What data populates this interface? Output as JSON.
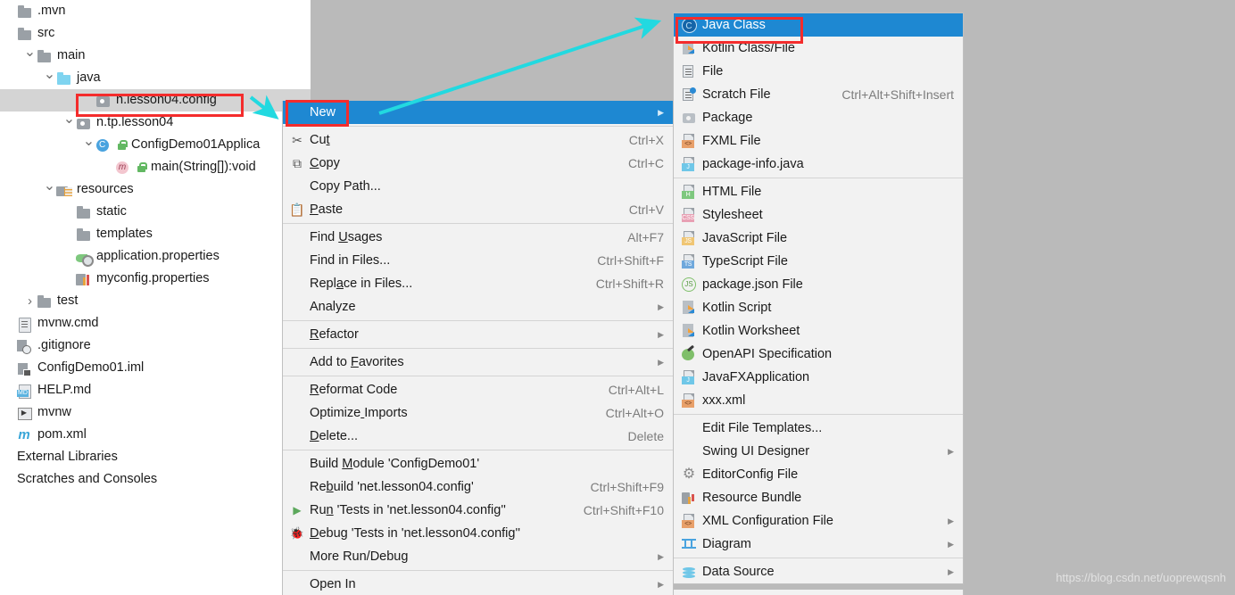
{
  "tree": {
    "items": [
      {
        "label": ".mvn",
        "indent": 0,
        "twist": "",
        "icon": "folder"
      },
      {
        "label": "src",
        "indent": 0,
        "twist": "",
        "icon": "folder"
      },
      {
        "label": "main",
        "indent": 1,
        "twist": "v",
        "icon": "folder"
      },
      {
        "label": "java",
        "indent": 2,
        "twist": "v",
        "icon": "folder-blue"
      },
      {
        "label": "n.lesson04.config",
        "indent": 4,
        "twist": "",
        "icon": "package",
        "selected": true
      },
      {
        "label": "n.tp.lesson04",
        "indent": 3,
        "twist": "v",
        "icon": "package"
      },
      {
        "label": "ConfigDemo01Applica",
        "indent": 4,
        "twist": "v",
        "icon": "spring-class",
        "lock": true
      },
      {
        "label": "main(String[]):void",
        "indent": 5,
        "twist": "",
        "icon": "method",
        "lock": true
      },
      {
        "label": "resources",
        "indent": 2,
        "twist": "v",
        "icon": "resources-folder"
      },
      {
        "label": "static",
        "indent": 3,
        "twist": "",
        "icon": "folder"
      },
      {
        "label": "templates",
        "indent": 3,
        "twist": "",
        "icon": "folder"
      },
      {
        "label": "application.properties",
        "indent": 3,
        "twist": "",
        "icon": "app-properties"
      },
      {
        "label": "myconfig.properties",
        "indent": 3,
        "twist": "",
        "icon": "properties"
      },
      {
        "label": "test",
        "indent": 1,
        "twist": ">",
        "icon": "folder"
      },
      {
        "label": "mvnw.cmd",
        "indent": 0,
        "twist": "",
        "icon": "file"
      },
      {
        "label": ".gitignore",
        "indent": 0,
        "twist": "",
        "icon": "gitignore"
      },
      {
        "label": "ConfigDemo01.iml",
        "indent": 0,
        "twist": "",
        "icon": "iml"
      },
      {
        "label": "HELP.md",
        "indent": 0,
        "twist": "",
        "icon": "markdown"
      },
      {
        "label": "mvnw",
        "indent": 0,
        "twist": "",
        "icon": "mvnw"
      },
      {
        "label": "pom.xml",
        "indent": 0,
        "twist": "",
        "icon": "maven"
      },
      {
        "label": "External Libraries",
        "indent": -1,
        "twist": "",
        "icon": "none"
      },
      {
        "label": "Scratches and Consoles",
        "indent": -1,
        "twist": "",
        "icon": "none"
      }
    ]
  },
  "context_menu": {
    "items": [
      {
        "label": "New",
        "icon": "none",
        "shortcut": "",
        "submenu": true,
        "highlighted": true
      },
      {
        "sep": true
      },
      {
        "label": "Cut",
        "icon": "scissors-icon",
        "shortcut": "Ctrl+X",
        "mnemonic": 2
      },
      {
        "label": "Copy",
        "icon": "copy-icon",
        "shortcut": "Ctrl+C",
        "mnemonic": 0
      },
      {
        "label": "Copy Path...",
        "icon": "none",
        "shortcut": ""
      },
      {
        "label": "Paste",
        "icon": "clipboard-icon",
        "shortcut": "Ctrl+V",
        "mnemonic": 0
      },
      {
        "sep": true
      },
      {
        "label": "Find Usages",
        "icon": "none",
        "shortcut": "Alt+F7",
        "mnemonic": 5
      },
      {
        "label": "Find in Files...",
        "icon": "none",
        "shortcut": "Ctrl+Shift+F"
      },
      {
        "label": "Replace in Files...",
        "icon": "none",
        "shortcut": "Ctrl+Shift+R",
        "mnemonic": 4
      },
      {
        "label": "Analyze",
        "icon": "none",
        "shortcut": "",
        "submenu": true
      },
      {
        "sep": true
      },
      {
        "label": "Refactor",
        "icon": "none",
        "shortcut": "",
        "submenu": true,
        "mnemonic": 0
      },
      {
        "sep": true
      },
      {
        "label": "Add to Favorites",
        "icon": "none",
        "shortcut": "",
        "submenu": true,
        "mnemonic": 7
      },
      {
        "sep": true
      },
      {
        "label": "Reformat Code",
        "icon": "none",
        "shortcut": "Ctrl+Alt+L",
        "mnemonic": 0
      },
      {
        "label": "Optimize Imports",
        "icon": "none",
        "shortcut": "Ctrl+Alt+O",
        "mnemonic": 8
      },
      {
        "label": "Delete...",
        "icon": "none",
        "shortcut": "Delete",
        "mnemonic": 0
      },
      {
        "sep": true
      },
      {
        "label": "Build Module 'ConfigDemo01'",
        "icon": "none",
        "shortcut": "",
        "mnemonic": 6
      },
      {
        "label": "Rebuild 'net.lesson04.config'",
        "icon": "none",
        "shortcut": "Ctrl+Shift+F9",
        "mnemonic": 2
      },
      {
        "label": "Run 'Tests in 'net.lesson04.config''",
        "icon": "run-icon",
        "shortcut": "Ctrl+Shift+F10",
        "mnemonic": 2
      },
      {
        "label": "Debug 'Tests in 'net.lesson04.config''",
        "icon": "debug-icon",
        "shortcut": "",
        "mnemonic": 0
      },
      {
        "label": "More Run/Debug",
        "icon": "none",
        "shortcut": "",
        "submenu": true
      },
      {
        "sep": true
      },
      {
        "label": "Open In",
        "icon": "none",
        "shortcut": "",
        "submenu": true
      }
    ]
  },
  "new_submenu": {
    "items": [
      {
        "label": "Java Class",
        "icon": "java-class-icon",
        "shortcut": "",
        "highlighted": true
      },
      {
        "label": "Kotlin Class/File",
        "icon": "kotlin-icon",
        "shortcut": ""
      },
      {
        "label": "File",
        "icon": "file-icon",
        "shortcut": ""
      },
      {
        "label": "Scratch File",
        "icon": "scratch-file-icon",
        "shortcut": "Ctrl+Alt+Shift+Insert"
      },
      {
        "label": "Package",
        "icon": "package-icon",
        "shortcut": ""
      },
      {
        "label": "FXML File",
        "icon": "fxml-file-icon",
        "shortcut": "",
        "tag": "<>",
        "tagColor": "#e8a06a"
      },
      {
        "label": "package-info.java",
        "icon": "java-file-icon",
        "shortcut": "",
        "tag": "J",
        "tagColor": "#6fc7e8"
      },
      {
        "sep": true
      },
      {
        "label": "HTML File",
        "icon": "html-file-icon",
        "shortcut": "",
        "tag": "H",
        "tagColor": "#7ec87e"
      },
      {
        "label": "Stylesheet",
        "icon": "css-file-icon",
        "shortcut": "",
        "tag": "CSS",
        "tagColor": "#e8a0b4"
      },
      {
        "label": "JavaScript File",
        "icon": "javascript-file-icon",
        "shortcut": "",
        "tag": "JS",
        "tagColor": "#f0c674"
      },
      {
        "label": "TypeScript File",
        "icon": "typescript-file-icon",
        "shortcut": "",
        "tag": "TS",
        "tagColor": "#6fa8dc"
      },
      {
        "label": "package.json File",
        "icon": "packagejson-icon",
        "shortcut": ""
      },
      {
        "label": "Kotlin Script",
        "icon": "kotlin-icon",
        "shortcut": ""
      },
      {
        "label": "Kotlin Worksheet",
        "icon": "kotlin-icon",
        "shortcut": ""
      },
      {
        "label": "OpenAPI Specification",
        "icon": "openapi-icon",
        "shortcut": ""
      },
      {
        "label": "JavaFXApplication",
        "icon": "java-file-icon",
        "shortcut": "",
        "tag": "J",
        "tagColor": "#6fc7e8"
      },
      {
        "label": "xxx.xml",
        "icon": "xml-file-icon",
        "shortcut": "",
        "tag": "<>",
        "tagColor": "#e8a06a"
      },
      {
        "sep": true
      },
      {
        "label": "Edit File Templates...",
        "icon": "none",
        "shortcut": ""
      },
      {
        "label": "Swing UI Designer",
        "icon": "none",
        "shortcut": "",
        "submenu": true
      },
      {
        "label": "EditorConfig File",
        "icon": "gear-icon",
        "shortcut": ""
      },
      {
        "label": "Resource Bundle",
        "icon": "resource-bundle-icon",
        "shortcut": ""
      },
      {
        "label": "XML Configuration File",
        "icon": "xml-file-icon",
        "shortcut": "",
        "submenu": true,
        "tag": "<>",
        "tagColor": "#e8a06a"
      },
      {
        "label": "Diagram",
        "icon": "diagram-icon",
        "shortcut": "",
        "submenu": true
      },
      {
        "sep": true
      },
      {
        "label": "Data Source",
        "icon": "database-icon",
        "shortcut": "",
        "submenu": true
      }
    ]
  },
  "annotations": {
    "watermark": "https://blog.csdn.net/uoprewqsnh",
    "highlight_color": "#f42c2c",
    "arrow_color": "#22d9e0",
    "selection_color": "#1e88d2"
  }
}
